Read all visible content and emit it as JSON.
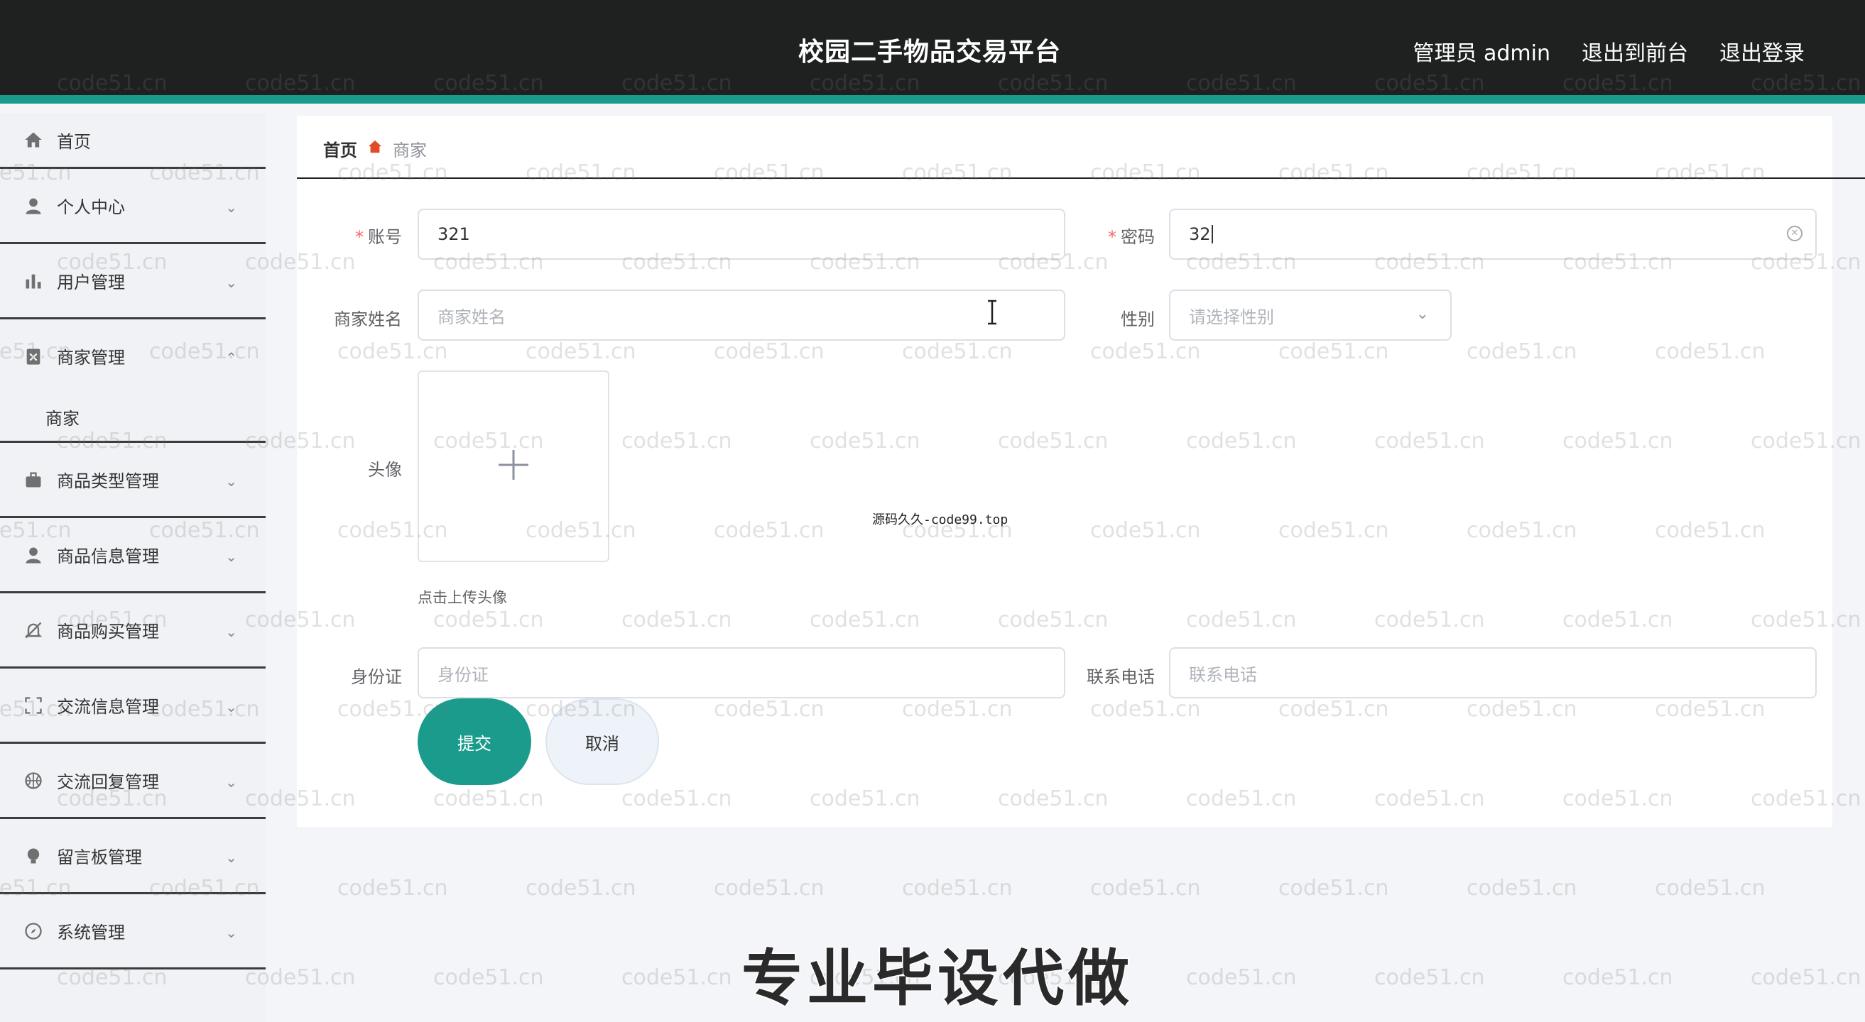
{
  "header": {
    "title": "校园二手物品交易平台",
    "links": [
      "管理员 admin",
      "退出到前台",
      "退出登录"
    ]
  },
  "sidebar": {
    "items": [
      {
        "label": "首页",
        "icon": "home-icon"
      },
      {
        "label": "个人中心",
        "icon": "user-icon",
        "arrow": "⌄"
      },
      {
        "label": "用户管理",
        "icon": "bar-chart-icon",
        "arrow": "⌄"
      },
      {
        "label": "商家管理",
        "icon": "clipboard-icon",
        "arrow": "⌃",
        "sub": [
          "商家"
        ]
      },
      {
        "label": "商品类型管理",
        "icon": "briefcase-icon",
        "arrow": "⌄"
      },
      {
        "label": "商品信息管理",
        "icon": "user-icon",
        "arrow": "⌄"
      },
      {
        "label": "商品购买管理",
        "icon": "bell-off-icon",
        "arrow": "⌄"
      },
      {
        "label": "交流信息管理",
        "icon": "fullscreen-icon",
        "arrow": "⌄"
      },
      {
        "label": "交流回复管理",
        "icon": "basketball-icon",
        "arrow": "⌄"
      },
      {
        "label": "留言板管理",
        "icon": "bulb-icon",
        "arrow": "⌄"
      },
      {
        "label": "系统管理",
        "icon": "compass-icon",
        "arrow": "⌄"
      }
    ]
  },
  "breadcrumb": {
    "home": "首页",
    "current": "商家",
    "separator_icon": "house-icon"
  },
  "form": {
    "account": {
      "label": "账号",
      "value": "321"
    },
    "password": {
      "label": "密码",
      "value": "32"
    },
    "merchant_name": {
      "label": "商家姓名",
      "placeholder": "商家姓名"
    },
    "gender": {
      "label": "性别",
      "placeholder": "请选择性别"
    },
    "avatar": {
      "label": "头像",
      "tip": "点击上传头像"
    },
    "id_card": {
      "label": "身份证",
      "placeholder": "身份证"
    },
    "phone": {
      "label": "联系电话",
      "placeholder": "联系电话"
    },
    "submit_label": "提交",
    "cancel_label": "取消"
  },
  "overlays": {
    "watermark_text": "code51.cn",
    "center_mark": "源码久久-code99.top",
    "banner": "专业毕设代做"
  },
  "colors": {
    "accent": "#1a9b8c",
    "topbar": "#1f2120",
    "required": "#f56c6c"
  }
}
